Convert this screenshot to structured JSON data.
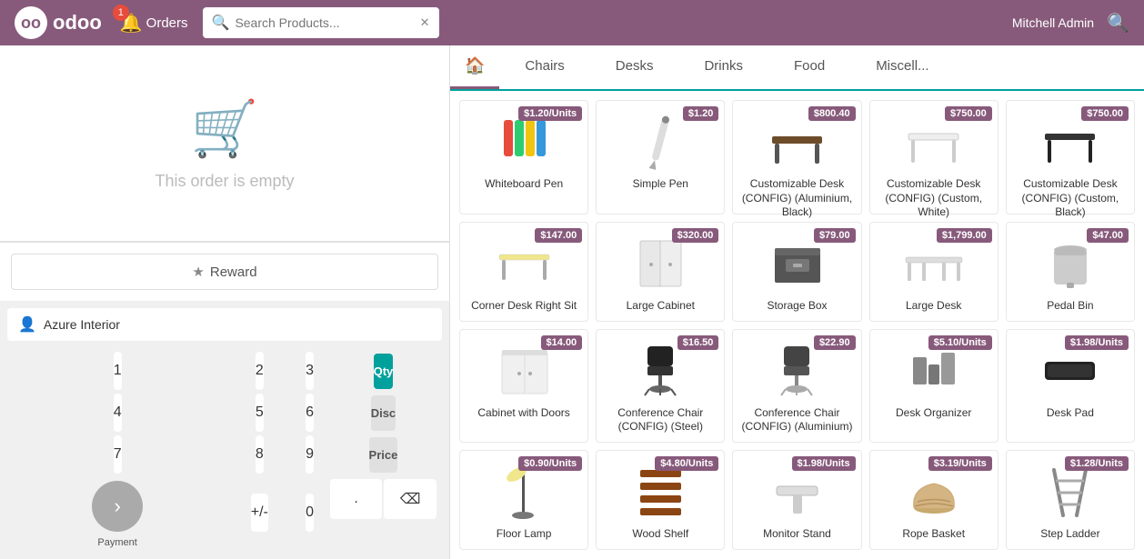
{
  "topbar": {
    "logo_text": "odoo",
    "orders_label": "Orders",
    "orders_badge": "1",
    "search_placeholder": "Search Products...",
    "user_name": "Mitchell Admin"
  },
  "left_panel": {
    "empty_order_text": "This order is empty",
    "reward_label": "Reward",
    "customer_name": "Azure Interior",
    "payment_label": "Payment"
  },
  "numpad": {
    "keys": [
      "1",
      "2",
      "3",
      "4",
      "5",
      "6",
      "7",
      "8",
      "9",
      "+/-",
      "0",
      "."
    ],
    "modes": [
      "Qty",
      "Disc",
      "Price"
    ]
  },
  "categories": [
    {
      "id": "home",
      "label": "🏠",
      "type": "home"
    },
    {
      "id": "chairs",
      "label": "Chairs"
    },
    {
      "id": "desks",
      "label": "Desks"
    },
    {
      "id": "drinks",
      "label": "Drinks"
    },
    {
      "id": "food",
      "label": "Food"
    },
    {
      "id": "misc",
      "label": "Miscell..."
    }
  ],
  "products": [
    {
      "name": "Whiteboard Pen",
      "price": "$1.20/Units",
      "type": "pen"
    },
    {
      "name": "Simple Pen",
      "price": "$1.20",
      "type": "simplepen"
    },
    {
      "name": "Customizable Desk (CONFIG) (Aluminium, Black)",
      "price": "$800.40",
      "type": "desk-dark"
    },
    {
      "name": "Customizable Desk (CONFIG) (Custom, White)",
      "price": "$750.00",
      "type": "desk-white"
    },
    {
      "name": "Customizable Desk (CONFIG) (Custom, Black)",
      "price": "$750.00",
      "type": "desk-black"
    },
    {
      "name": "Corner Desk Right Sit",
      "price": "$147.00",
      "type": "corner-desk"
    },
    {
      "name": "Large Cabinet",
      "price": "$320.00",
      "type": "cabinet"
    },
    {
      "name": "Storage Box",
      "price": "$79.00",
      "type": "storage-box"
    },
    {
      "name": "Large Desk",
      "price": "$1,799.00",
      "type": "large-desk"
    },
    {
      "name": "Pedal Bin",
      "price": "$47.00",
      "type": "pedal-bin"
    },
    {
      "name": "Cabinet with Doors",
      "price": "$14.00",
      "type": "cabinet-doors"
    },
    {
      "name": "Conference Chair (CONFIG) (Steel)",
      "price": "$16.50",
      "type": "chair-steel"
    },
    {
      "name": "Conference Chair (CONFIG) (Aluminium)",
      "price": "$22.90",
      "type": "chair-alum"
    },
    {
      "name": "Desk Organizer",
      "price": "$5.10/Units",
      "type": "organizer"
    },
    {
      "name": "Desk Pad",
      "price": "$1.98/Units",
      "type": "desk-pad"
    },
    {
      "name": "Floor Lamp",
      "price": "$0.90/Units",
      "type": "floor-lamp"
    },
    {
      "name": "Wood Shelf",
      "price": "$4.80/Units",
      "type": "wood-shelf"
    },
    {
      "name": "Monitor Stand",
      "price": "$1.98/Units",
      "type": "monitor-stand"
    },
    {
      "name": "Rope Basket",
      "price": "$3.19/Units",
      "type": "rope-basket"
    },
    {
      "name": "Step Ladder",
      "price": "$1.28/Units",
      "type": "step-ladder"
    }
  ],
  "colors": {
    "brand_purple": "#875a7b",
    "brand_teal": "#00a09d",
    "accent_red": "#e74c3c"
  }
}
